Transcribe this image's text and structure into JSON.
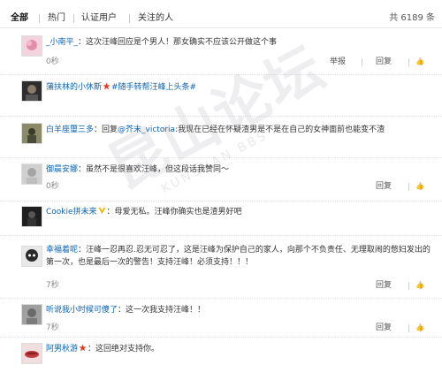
{
  "tabs": [
    {
      "label": "全部",
      "active": true
    },
    {
      "label": "热门",
      "active": false
    },
    {
      "label": "认证用户",
      "active": false
    },
    {
      "label": "关注的人",
      "active": false
    }
  ],
  "total_label": "共 6189 条",
  "actions": {
    "report": "举报",
    "reply": "回复"
  },
  "watermark": {
    "main": "昆山论坛",
    "sub": "KUNSHAN BBS"
  },
  "comments": [
    {
      "user": "_小南平_",
      "text": "：这次汪峰回应是个男人！那女确实不应该公开做这个事",
      "time": "0秒",
      "avatar_color": "#e9b7c7"
    },
    {
      "user": "蒲扶林的小休斯",
      "has_badge": true,
      "text": "#随手转帮汪峰上头条#",
      "avatar_color": "#3a3a3a"
    },
    {
      "user": "白羊座璽三多",
      "text_before": "：回复",
      "mention": "@芥末_victoria",
      "text": ":我现在已经在怀疑渣男是不是在自己的女神面前也能变不渣",
      "avatar_color": "#6b6b4a"
    },
    {
      "user": "御晨安娜",
      "text": "：虽然不是很喜欢汪峰，但这段话我赞同～",
      "time": "0秒",
      "avatar_color": "#b8b8b8"
    },
    {
      "user": "Cookie拼未来",
      "has_vip": true,
      "text": "：母爱无私。汪峰你确实也是渣男好吧",
      "avatar_color": "#2a2a2a"
    },
    {
      "user": "幸福着呢",
      "text": "：汪峰一忍再忍.忍无可忍了，这是汪峰为保护自己的家人，向那个不负责任、无理取闹的憋妇发出的 第一次，也是最后一次的警告！支持汪峰！必须支持！！！",
      "time": "7秒",
      "avatar_color": "#3b3b3b"
    },
    {
      "user": "听说我小时候可傻了",
      "text": "：这一次我支持汪峰！！",
      "time": "7秒",
      "avatar_color": "#8a8a8a"
    },
    {
      "user": "阿男秋游",
      "has_badge": true,
      "text": "：这回绝对支持你。",
      "avatar_color": "#c23a3a"
    }
  ]
}
